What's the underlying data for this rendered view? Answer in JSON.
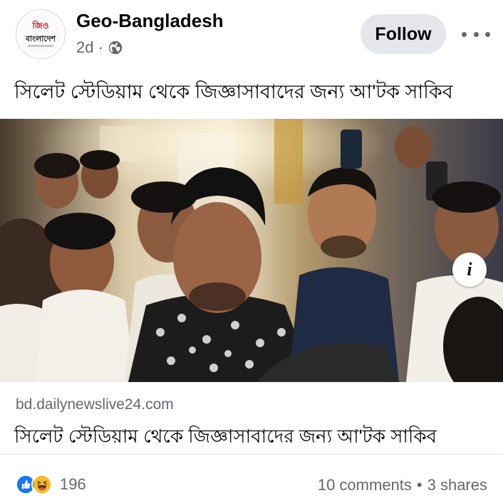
{
  "post": {
    "page_name": "Geo-Bangladesh",
    "time": "2d",
    "separator": "·",
    "privacy_icon": "globe-icon",
    "avatar": {
      "line1": "জিও",
      "line2": "বাংলাদেশ"
    },
    "follow_label": "Follow",
    "more_icon": "more-options-icon",
    "text": "সিলেট স্টেডিয়াম থেকে জিজ্ঞাসাবাদের জন্য আ'টক সাকিব"
  },
  "photo": {
    "info_label": "i"
  },
  "link": {
    "domain": "bd.dailynewslive24.com",
    "title": "সিলেট স্টেডিয়াম থেকে জিজ্ঞাসাবাদের জন্য আ'টক সাকিব"
  },
  "footer": {
    "reaction_icons": [
      "like-icon",
      "haha-icon"
    ],
    "reaction_count": "196",
    "comments": "10 comments",
    "separator": "•",
    "shares": "3 shares"
  },
  "colors": {
    "follow_bg": "#e4e6eb",
    "like_blue": "#1877f2",
    "haha_yellow": "#f7b928",
    "secondary_text": "#65676b"
  }
}
